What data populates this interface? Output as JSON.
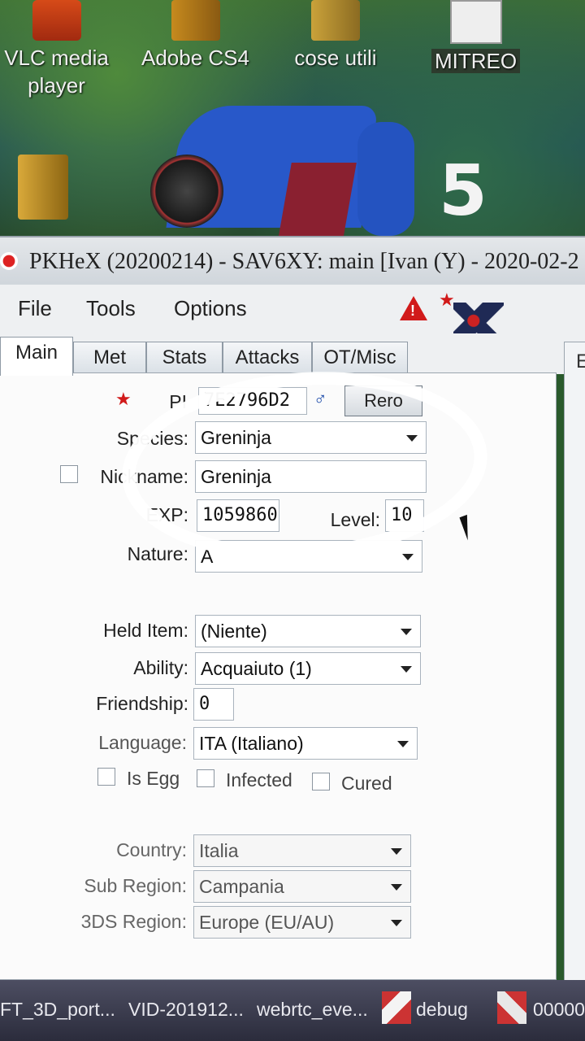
{
  "desktop": {
    "icons": [
      {
        "name": "vlc",
        "line1": "VLC media",
        "line2": "player"
      },
      {
        "name": "adobe",
        "line1": "Adobe CS4",
        "line2": ""
      },
      {
        "name": "cose",
        "line1": "cose utili",
        "line2": ""
      },
      {
        "name": "mitreo",
        "line1": "MITREO",
        "line2": ""
      }
    ],
    "wallpaper_text": "5"
  },
  "window": {
    "title": "PKHeX (20200214) - SAV6XY: main [Ivan (Y) - 2020-02-2"
  },
  "menu": {
    "file": "File",
    "tools": "Tools",
    "options": "Options"
  },
  "tabs": {
    "main": "Main",
    "met": "Met",
    "stats": "Stats",
    "attacks": "Attacks",
    "ot_misc": "OT/Misc"
  },
  "right_panel": {
    "label": "E"
  },
  "main": {
    "pid_label": "PI",
    "pid_value": "7E2796D2",
    "reroll_label": "Rero",
    "species_label": "Species:",
    "species_value": "Greninja",
    "nickname_label": "Nickname:",
    "nickname_value": "Greninja",
    "exp_label": "EXP:",
    "exp_value": "1059860",
    "level_label": "Level:",
    "level_value": "10",
    "nature_label": "Nature:",
    "nature_value": "A",
    "held_item_label": "Held Item:",
    "held_item_value": "(Niente)",
    "ability_label": "Ability:",
    "ability_value": "Acquaiuto (1)",
    "friendship_label": "Friendship:",
    "friendship_value": "0",
    "language_label": "Language:",
    "language_value": "ITA (Italiano)",
    "is_egg_label": "Is Egg",
    "infected_label": "Infected",
    "cured_label": "Cured",
    "country_label": "Country:",
    "country_value": "Italia",
    "sub_region_label": "Sub Region:",
    "sub_region_value": "Campania",
    "region_3ds_label": "3DS Region:",
    "region_3ds_value": "Europe (EU/AU)"
  },
  "taskbar": {
    "items": [
      "FT_3D_port...",
      "VID-201912...",
      "webrtc_eve...",
      "debug",
      "00000"
    ]
  },
  "colors": {
    "accent_red": "#d11a1a",
    "taskbar": "#2b2c3c"
  }
}
